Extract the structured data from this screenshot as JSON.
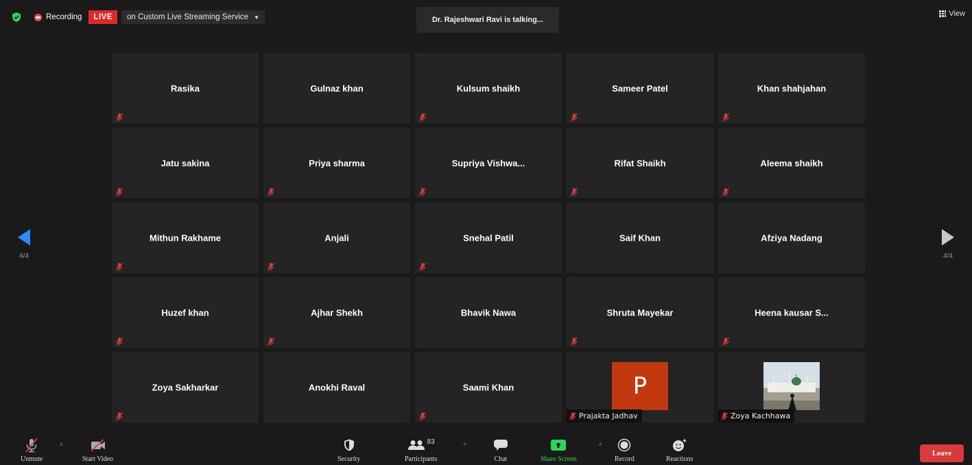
{
  "topbar": {
    "recording_label": "Recording",
    "live_label": "LIVE",
    "stream_service": "on Custom Live Streaming Service"
  },
  "talking_banner": "Dr. Rajeshwari Ravi is talking...",
  "view_label": "View",
  "pagination": {
    "left": "4/4",
    "right": "4/4"
  },
  "participants": [
    {
      "name": "Rasika",
      "muted": true
    },
    {
      "name": "Gulnaz khan",
      "muted": false
    },
    {
      "name": "Kulsum shaikh",
      "muted": true
    },
    {
      "name": "Sameer Patel",
      "muted": true
    },
    {
      "name": "Khan shahjahan",
      "muted": true
    },
    {
      "name": "Jatu sakina",
      "muted": true
    },
    {
      "name": "Priya sharma",
      "muted": true
    },
    {
      "name": "Supriya  Vishwa...",
      "muted": true
    },
    {
      "name": "Rifat Shaikh",
      "muted": true
    },
    {
      "name": "Aleema shaikh",
      "muted": true
    },
    {
      "name": "Mithun Rakhame",
      "muted": true
    },
    {
      "name": "Anjali",
      "muted": true
    },
    {
      "name": "Snehal Patil",
      "muted": true
    },
    {
      "name": "Saif Khan",
      "muted": false
    },
    {
      "name": "Afziya Nadang",
      "muted": false
    },
    {
      "name": "Huzef khan",
      "muted": true
    },
    {
      "name": "Ajhar Shekh",
      "muted": true
    },
    {
      "name": "Bhavik Nawa",
      "muted": false
    },
    {
      "name": "Shruta Mayekar",
      "muted": true
    },
    {
      "name": "Heena  kausar  S...",
      "muted": true
    },
    {
      "name": "Zoya Sakharkar",
      "muted": true
    },
    {
      "name": "Anokhi Raval",
      "muted": false
    },
    {
      "name": "Saami Khan",
      "muted": true
    }
  ],
  "avatar_tiles": {
    "prajakta": {
      "initial": "P",
      "name": "Prajakta Jadhav",
      "color": "#c2380f"
    },
    "zoya": {
      "name": "Zoya Kachhawa"
    }
  },
  "toolbar": {
    "unmute": "Unmute",
    "start_video": "Start Video",
    "security": "Security",
    "participants": "Participants",
    "participants_count": "83",
    "chat": "Chat",
    "share_screen": "Share Screen",
    "record": "Record",
    "reactions": "Reactions",
    "leave": "Leave"
  },
  "colors": {
    "accent_blue": "#2d8cff",
    "live_red": "#e02828",
    "share_green": "#2bd65a",
    "leave_red": "#d83b3b"
  }
}
